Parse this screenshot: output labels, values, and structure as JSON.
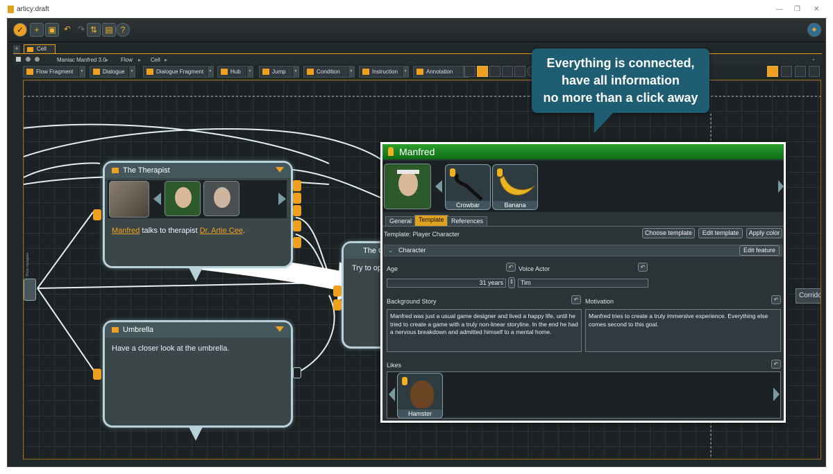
{
  "window": {
    "title": "articy:draft",
    "minimize": "—",
    "restore": "❐",
    "close": "✕"
  },
  "tabs": {
    "plus": "+",
    "cell": "Cell"
  },
  "breadcrumb": [
    "Maniac Manfred 3.0",
    "Flow",
    "Cell"
  ],
  "toolbar": [
    "Flow Fragment",
    "Dialogue",
    "Dialogue Fragment",
    "Hub",
    "Jump",
    "Condition",
    "Instruction",
    "Annotation"
  ],
  "callout": {
    "line1": "Everything is connected,",
    "line2": "have all information",
    "line3": "no more than a click away"
  },
  "nodes": {
    "therapist": {
      "title": "The Therapist",
      "text_pre": " talks to therapist ",
      "link1": "Manfred",
      "link2": "Dr. Artie Cee",
      "text_post": "."
    },
    "umbrella": {
      "title": "Umbrella",
      "text": "Have a closer look at the umbrella."
    },
    "closet": {
      "title": "The Clo",
      "text": "Try to open"
    },
    "corridor": "Corridor"
  },
  "side_nav": "Show navigator",
  "panel": {
    "name": "Manfred",
    "items": [
      "Crowbar",
      "Banana"
    ],
    "tabs": [
      "General",
      "Template",
      "References"
    ],
    "template_label": "Template: Player Character",
    "buttons": {
      "choose": "Choose template",
      "edit": "Edit template",
      "apply": "Apply color",
      "edit_feature": "Edit feature"
    },
    "section": "Character",
    "age_label": "Age",
    "age_value": "31 years",
    "voice_label": "Voice Actor",
    "voice_value": "Tim",
    "bg_label": "Background Story",
    "bg_text": "Manfred was just a usual game designer and lived a happy life, until he tried to create a game with a truly non-linear storyline. In the end he had a nervous breakdown and admitted himself to a mental home.",
    "motivation_label": "Motivation",
    "motivation_text": "Manfred tries to create a truly immersive experience. Everything else comes second to this goal.",
    "likes_label": "Likes",
    "likes": [
      "Hamster"
    ]
  },
  "colors": {
    "accent": "#f0a020",
    "header_green": "#1a8a22",
    "callout": "#1e5d72"
  }
}
